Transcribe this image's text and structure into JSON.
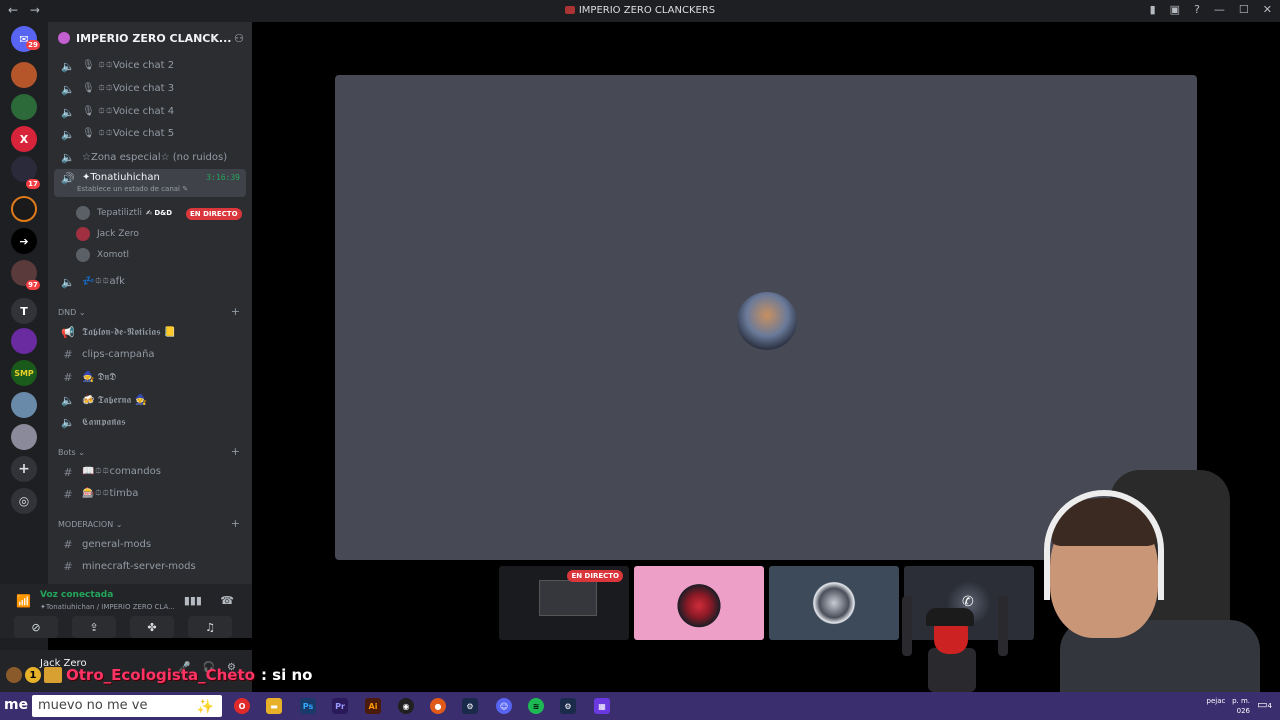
{
  "window": {
    "title": "IMPERIO ZERO CLANCKERS",
    "back_icon": "←",
    "forward_icon": "→",
    "right_icons": [
      "bookmark-icon",
      "screen-icon",
      "help-icon",
      "minimize-icon",
      "maximize-icon",
      "close-icon"
    ],
    "right_glyphs": [
      "▮",
      "▣",
      "?",
      "—",
      "☐",
      "✕"
    ]
  },
  "guilds": {
    "badges": [
      "29",
      "17",
      "97"
    ],
    "letter_server": "T"
  },
  "server": {
    "name": "IMPERIO ZERO CLANCK...",
    "chevron": "⌄"
  },
  "channels": {
    "voice": [
      {
        "name": "🎙 ⯐⯐Voice chat 2"
      },
      {
        "name": "🎙 ⯐⯐Voice chat 3"
      },
      {
        "name": "🎙 ⯐⯐Voice chat 4"
      },
      {
        "name": "🎙 ⯐⯐Voice chat 5"
      },
      {
        "name": "☆Zona especial☆ (no ruidos)"
      }
    ],
    "active": {
      "name": "✦Tonatiuhichan",
      "timer": "3:16:39",
      "status": "Establece un estado de canal ✎"
    },
    "users": [
      {
        "name": "Tepatiliztli",
        "tag": "✍ D&D",
        "live": "EN DIRECTO"
      },
      {
        "name": "Jack Zero"
      },
      {
        "name": "Xomotl"
      }
    ],
    "afk": "💤⯐⯐afk",
    "categories": {
      "dnd": "DND ⌄",
      "bots": "Bots ⌄",
      "moderacion": "MODERACION ⌄"
    },
    "dnd_channels": [
      {
        "name": "𝕿𝖆𝖇𝖑𝖔𝖓-𝖉𝖊-𝕹𝖔𝖙𝖎𝖈𝖎𝖆𝖘 📒"
      },
      {
        "name": "clips-campaña"
      },
      {
        "name": "🧙 𝕯𝖓𝕯"
      },
      {
        "name": "🍻 𝕿𝖆𝖇𝖊𝖗𝖓𝖆 🧙"
      },
      {
        "name": "𝕮𝖆𝖒𝖕𝖆𝖓̃𝖆𝖘"
      }
    ],
    "bot_channels": [
      {
        "name": "📖⯐⯐comandos"
      },
      {
        "name": "🎰⯐⯐timba"
      }
    ],
    "mod_channels": [
      {
        "name": "general-mods"
      },
      {
        "name": "minecraft-server-mods"
      }
    ]
  },
  "voice_panel": {
    "status": "Voz conectada",
    "location": "✦Tonatiuhichan / IMPERIO ZERO CLA..."
  },
  "user_panel": {
    "name": "Jack Zero"
  },
  "stream": {
    "live_label": "EN DIRECTO"
  },
  "chat_overlay": {
    "badge": "1",
    "username": "Otro_Ecologista_Cheto",
    "message": ": si no"
  },
  "taskbar": {
    "logo": "me",
    "search_text": "muevo no me ve",
    "tray_text": "pejac",
    "clock_line1": "p. m.",
    "clock_line2": "026",
    "notif_badge": "4"
  }
}
